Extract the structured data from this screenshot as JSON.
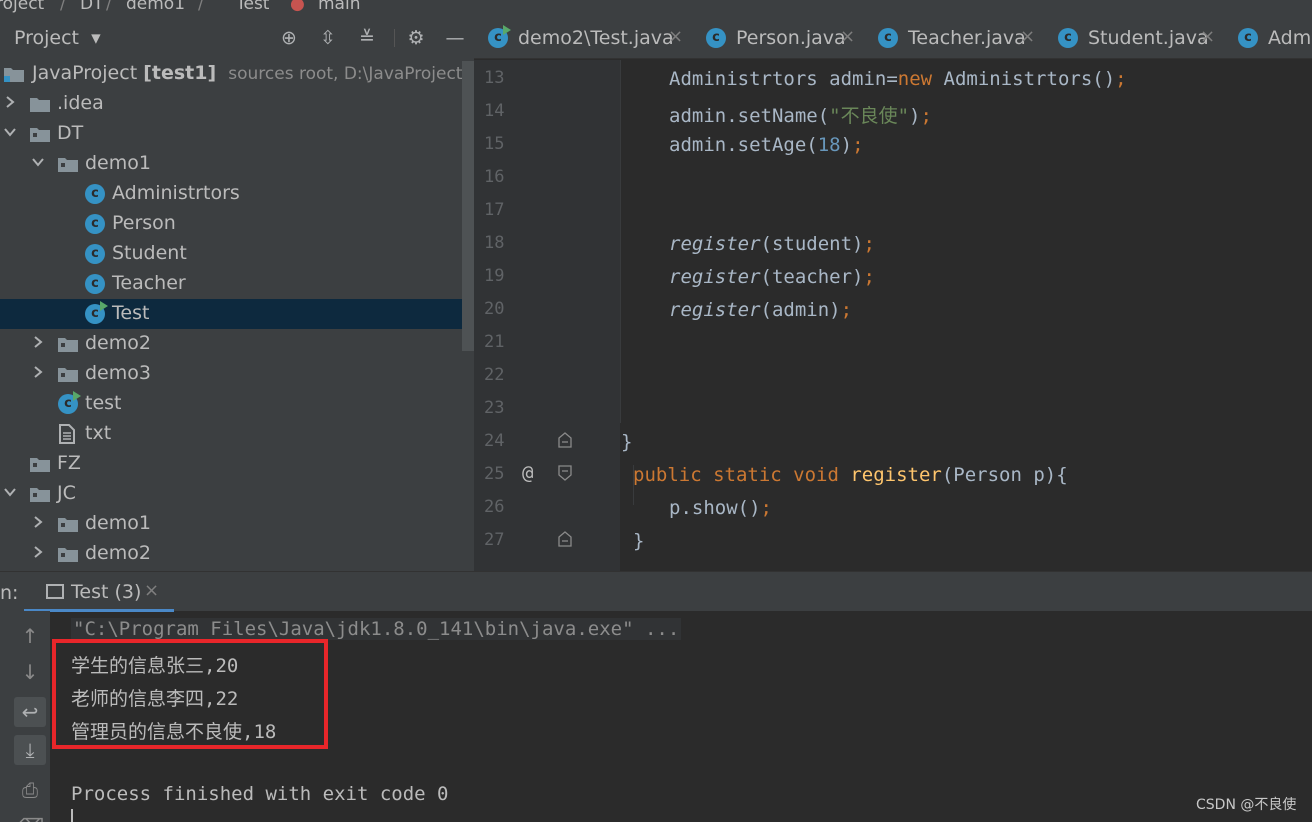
{
  "breadcrumb": [
    "roject",
    "DT",
    "demo1",
    "Test",
    "main"
  ],
  "project_panel": {
    "title": "Project",
    "tree": [
      {
        "label": "JavaProject",
        "bold": "[test1]",
        "hint": "sources root,  D:\\JavaProject",
        "type": "module"
      },
      {
        "label": ".idea",
        "type": "folder"
      },
      {
        "label": "DT",
        "type": "folder"
      },
      {
        "label": "demo1",
        "type": "package"
      },
      {
        "label": "Administrtors",
        "type": "class"
      },
      {
        "label": "Person",
        "type": "class"
      },
      {
        "label": "Student",
        "type": "class"
      },
      {
        "label": "Teacher",
        "type": "class"
      },
      {
        "label": "Test",
        "type": "class-main"
      },
      {
        "label": "demo2",
        "type": "package"
      },
      {
        "label": "demo3",
        "type": "package"
      },
      {
        "label": "test",
        "type": "class-main"
      },
      {
        "label": "txt",
        "type": "file"
      },
      {
        "label": "FZ",
        "type": "folder"
      },
      {
        "label": "JC",
        "type": "folder"
      },
      {
        "label": "demo1",
        "type": "package"
      },
      {
        "label": "demo2",
        "type": "package"
      }
    ]
  },
  "editor": {
    "tabs": [
      "demo2\\Test.java",
      "Person.java",
      "Teacher.java",
      "Student.java",
      "Admi"
    ],
    "lines": [
      "13",
      "14",
      "15",
      "16",
      "17",
      "18",
      "19",
      "20",
      "21",
      "22",
      "23",
      "24",
      "25",
      "26",
      "27"
    ],
    "code": {
      "l13": {
        "a": "Administrtors admin=",
        "kw": "new",
        "b": " Administrtors()",
        "semi": ";"
      },
      "l14": {
        "a": "admin.setName(",
        "str": "\"不良使\"",
        "b": ")",
        "semi": ";"
      },
      "l15": {
        "a": "admin.setAge(",
        "num": "18",
        "b": ")",
        "semi": ";"
      },
      "l18": {
        "fn": "register",
        "b": "(student)",
        "semi": ";"
      },
      "l19": {
        "fn": "register",
        "b": "(teacher)",
        "semi": ";"
      },
      "l20": {
        "fn": "register",
        "b": "(admin)",
        "semi": ";"
      },
      "l24": {
        "b": "}"
      },
      "l25": {
        "kw": "public static void ",
        "fn": "register",
        "b": "(Person p){"
      },
      "l26": {
        "a": "p.show()",
        "semi": ";"
      },
      "l27": {
        "b": "}"
      }
    },
    "override_marker": "@"
  },
  "run_panel": {
    "prefix": "n:",
    "tab_label": "Test (3)",
    "output": [
      "\"C:\\Program Files\\Java\\jdk1.8.0_141\\bin\\java.exe\" ...",
      "学生的信息张三,20",
      "老师的信息李四,22",
      "管理员的信息不良使,18",
      "Process finished with exit code 0"
    ],
    "highlight_color": "#e8262a"
  },
  "watermark": "CSDN @不良使"
}
